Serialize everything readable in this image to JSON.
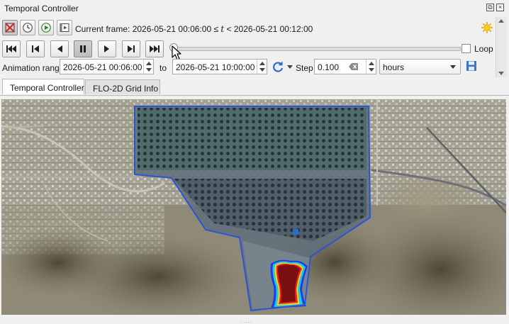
{
  "window": {
    "title": "Temporal Controller"
  },
  "controls": {
    "frame_label_prefix": "Current frame: 2026-05-21 00:06:00 ≤ ",
    "frame_label_var": "t",
    "frame_label_suffix": " < 2026-05-21 00:12:00",
    "loop_label": "Loop",
    "loop_checked": false,
    "slider_position": 0.0
  },
  "range": {
    "label": "Animation range",
    "start": "2026-05-21 00:06:00",
    "to_label": "to",
    "end": "2026-05-21 10:00:00",
    "step_label": "Step",
    "step_value": "0.100",
    "step_unit": "hours"
  },
  "tabs": [
    {
      "label": "Temporal Controller",
      "active": true
    },
    {
      "label": "FLO-2D Grid Info",
      "active": false
    }
  ],
  "colors": {
    "accent": "#2a6bd8",
    "boundary": "#2a55d6",
    "flood_core": "#7a1010",
    "flood_edge_red": "#e82020",
    "flood_edge_yellow": "#f2d21a",
    "flood_edge_cyan": "#1ec8e8",
    "flood_edge_blue": "#2040e0"
  },
  "icons": {
    "settings": "sun-gear-icon",
    "save": "floppy-disk-icon",
    "refresh": "refresh-icon"
  }
}
